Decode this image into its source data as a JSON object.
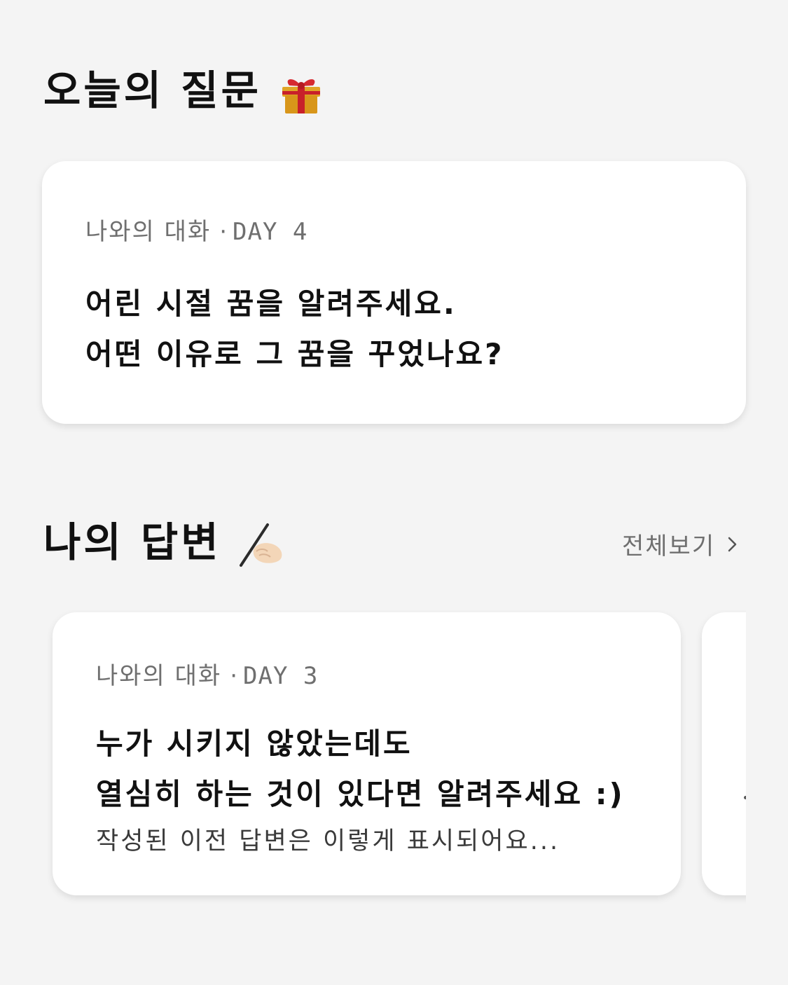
{
  "today": {
    "title": "오늘의 질문",
    "title_emoji": "gift-icon",
    "card": {
      "category": "나와의 대화",
      "separator": "·",
      "day": "DAY 4",
      "question_lines": [
        "어린 시절 꿈을 알려주세요.",
        "어떤 이유로 그 꿈을 꾸었나요?"
      ]
    }
  },
  "answers": {
    "title": "나의 답변",
    "title_emoji": "writing-hand-icon",
    "view_all_label": "전체보기",
    "cards": [
      {
        "category": "나와의 대화",
        "separator": "·",
        "day": "DAY 3",
        "question_lines": [
          "누가 시키지 않았는데도",
          "열심히 하는 것이 있다면 알려주세요 :)"
        ],
        "answer_preview": "작성된 이전 답변은 이렇게 표시되어요..."
      }
    ]
  },
  "colors": {
    "background": "#f4f4f4",
    "card": "#ffffff",
    "text_primary": "#111111",
    "text_secondary": "#6f6f6f"
  }
}
